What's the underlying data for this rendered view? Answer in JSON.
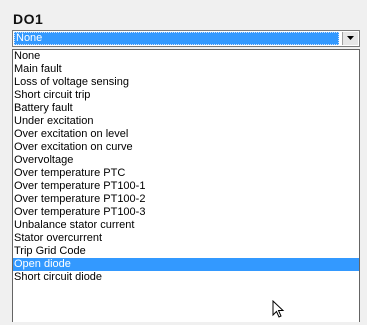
{
  "field": {
    "label": "DO1"
  },
  "combo": {
    "selected_value": "None"
  },
  "dropdown": {
    "highlighted_index": 16,
    "options": [
      {
        "label": "None"
      },
      {
        "label": "Main fault"
      },
      {
        "label": "Loss of voltage sensing"
      },
      {
        "label": "Short circuit trip"
      },
      {
        "label": "Battery fault"
      },
      {
        "label": "Under excitation"
      },
      {
        "label": "Over excitation on level"
      },
      {
        "label": "Over excitation on curve"
      },
      {
        "label": "Overvoltage"
      },
      {
        "label": "Over temperature PTC"
      },
      {
        "label": "Over temperature PT100-1"
      },
      {
        "label": "Over temperature PT100-2"
      },
      {
        "label": "Over temperature PT100-3"
      },
      {
        "label": "Unbalance stator current"
      },
      {
        "label": "Stator overcurrent"
      },
      {
        "label": "Trip Grid Code"
      },
      {
        "label": "Open diode"
      },
      {
        "label": "Short circuit diode"
      }
    ]
  },
  "icons": {
    "dropdown_arrow": "chevron-down-icon",
    "cursor": "mouse-pointer-icon"
  },
  "colors": {
    "selection": "#3399ff",
    "background": "#f0f0f0"
  }
}
